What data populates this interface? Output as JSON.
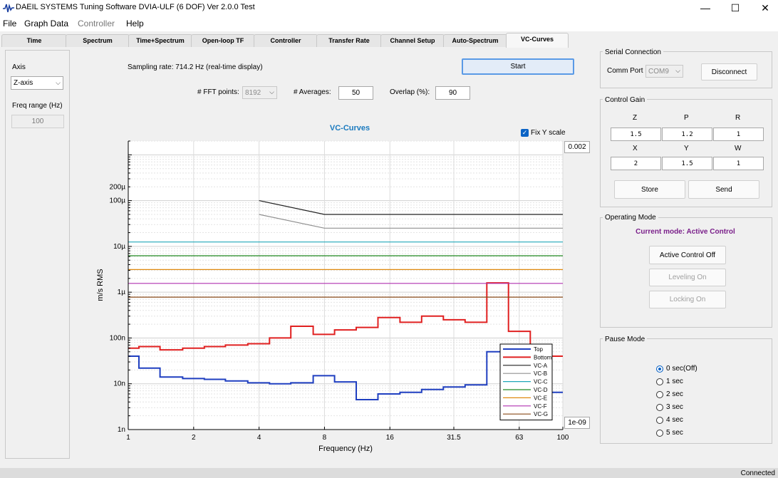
{
  "window": {
    "title": "DAEIL SYSTEMS Tuning Software DVIA-ULF (6 DOF) Ver 2.0.0 Test",
    "minimize": "—",
    "maximize": "☐",
    "close": "✕"
  },
  "menu": {
    "items": [
      "File",
      "Graph Data",
      "Controller",
      "Help"
    ]
  },
  "tabs": [
    "Time",
    "Spectrum",
    "Time+Spectrum",
    "Open-loop TF",
    "Controller",
    "Transfer Rate",
    "Channel Setup",
    "Auto-Spectrum",
    "VC-Curves"
  ],
  "active_tab": "VC-Curves",
  "left_panel": {
    "axis_label": "Axis",
    "axis_value": "Z-axis",
    "freq_range_label": "Freq range (Hz)",
    "freq_range_value": "100"
  },
  "top_controls": {
    "sampling_rate": "Sampling rate: 714.2 Hz (real-time display)",
    "start_button": "Start",
    "fft_points_label": "# FFT points:",
    "fft_points_value": "8192",
    "averages_label": "# Averages:",
    "averages_value": "50",
    "overlap_label": "Overlap (%):",
    "overlap_value": "90",
    "fix_y_label": "Fix Y scale",
    "fix_y_checked": true,
    "y_max_value": "0.002",
    "y_min_value": "1e-09"
  },
  "chart_data": {
    "type": "line",
    "title": "VC-Curves",
    "xlabel": "Frequency (Hz)",
    "ylabel": "m/s RMS",
    "x_scale": "log",
    "y_scale": "log",
    "xlim": [
      1,
      100
    ],
    "ylim": [
      1e-09,
      0.002
    ],
    "x_ticks": [
      1,
      2,
      4,
      8,
      16,
      31.5,
      63,
      100
    ],
    "x_tick_labels": [
      "1",
      "2",
      "4",
      "8",
      "16",
      "31.5",
      "63",
      "100"
    ],
    "y_ticks": [
      1e-09,
      1e-08,
      1e-07,
      1e-06,
      1e-05,
      0.0001,
      0.0002
    ],
    "y_tick_labels": [
      "1n",
      "10n",
      "100n",
      "1µ",
      "10µ",
      "100µ",
      "200µ"
    ],
    "grid": true,
    "legend_position": "bottom-right",
    "series": [
      {
        "name": "Top",
        "color": "#1f3fc0",
        "width": 2,
        "step": true,
        "x": [
          1,
          1.12,
          1.4,
          1.78,
          2.24,
          2.8,
          3.55,
          4.47,
          5.6,
          7.1,
          8.9,
          11.2,
          14.1,
          17.8,
          22.4,
          28.2,
          35.5,
          44.7,
          56.2,
          70.8,
          89.1,
          100
        ],
        "y": [
          4e-08,
          2.2e-08,
          1.4e-08,
          1.3e-08,
          1.25e-08,
          1.15e-08,
          1.05e-08,
          1e-08,
          1.05e-08,
          1.5e-08,
          1.1e-08,
          4.5e-09,
          6e-09,
          6.5e-09,
          7.5e-09,
          8.5e-09,
          9.5e-09,
          5e-08,
          5e-08,
          6.5e-09,
          6.5e-09,
          6.5e-09
        ]
      },
      {
        "name": "Bottom",
        "color": "#e02020",
        "width": 2,
        "step": true,
        "x": [
          1,
          1.12,
          1.4,
          1.78,
          2.24,
          2.8,
          3.55,
          4.47,
          5.6,
          7.1,
          8.9,
          11.2,
          14.1,
          17.8,
          22.4,
          28.2,
          35.5,
          44.7,
          56.2,
          70.8,
          89.1,
          100
        ],
        "y": [
          6e-08,
          6.5e-08,
          5.5e-08,
          6e-08,
          6.5e-08,
          7e-08,
          7.5e-08,
          1e-07,
          1.8e-07,
          1.2e-07,
          1.5e-07,
          1.7e-07,
          2.8e-07,
          2.2e-07,
          3e-07,
          2.5e-07,
          2.2e-07,
          1.6e-06,
          1.4e-07,
          4e-08,
          4e-08,
          4e-08
        ]
      },
      {
        "name": "VC-A",
        "color": "#222222",
        "width": 1.2,
        "x": [
          4,
          8,
          100
        ],
        "y": [
          0.0001,
          5e-05,
          5e-05
        ]
      },
      {
        "name": "VC-B",
        "color": "#909090",
        "width": 1.2,
        "x": [
          4,
          8,
          100
        ],
        "y": [
          5e-05,
          2.5e-05,
          2.5e-05
        ]
      },
      {
        "name": "VC-C",
        "color": "#20a8b8",
        "width": 1.2,
        "x": [
          1,
          100
        ],
        "y": [
          1.25e-05,
          1.25e-05
        ]
      },
      {
        "name": "VC-D",
        "color": "#208a20",
        "width": 1.2,
        "x": [
          1,
          100
        ],
        "y": [
          6.25e-06,
          6.25e-06
        ]
      },
      {
        "name": "VC-E",
        "color": "#e08a10",
        "width": 1.2,
        "x": [
          1,
          100
        ],
        "y": [
          3.12e-06,
          3.12e-06
        ]
      },
      {
        "name": "VC-F",
        "color": "#b030b0",
        "width": 1.2,
        "x": [
          1,
          100
        ],
        "y": [
          1.56e-06,
          1.56e-06
        ]
      },
      {
        "name": "VC-G",
        "color": "#8a4a18",
        "width": 1.2,
        "x": [
          1,
          100
        ],
        "y": [
          7.8e-07,
          7.8e-07
        ]
      }
    ]
  },
  "serial": {
    "group_title": "Serial Connection",
    "comm_port_label": "Comm Port",
    "comm_port_value": "COM9",
    "disconnect_button": "Disconnect"
  },
  "control_gain": {
    "group_title": "Control Gain",
    "row1_headers": [
      "Z",
      "P",
      "R"
    ],
    "row1_values": [
      "1.5",
      "1.2",
      "1"
    ],
    "row2_headers": [
      "X",
      "Y",
      "W"
    ],
    "row2_values": [
      "2",
      "1.5",
      "1"
    ],
    "store_button": "Store",
    "send_button": "Send"
  },
  "operating_mode": {
    "group_title": "Operating Mode",
    "current_mode": "Current mode: Active Control",
    "current_mode_color": "#7a1f8a",
    "active_control_button": "Active Control Off",
    "leveling_button": "Leveling On",
    "locking_button": "Locking On"
  },
  "pause_mode": {
    "group_title": "Pause Mode",
    "options": [
      "0 sec(Off)",
      "1 sec",
      "2 sec",
      "3 sec",
      "4 sec",
      "5 sec"
    ],
    "selected_index": 0
  },
  "status": {
    "text": "Connected"
  }
}
